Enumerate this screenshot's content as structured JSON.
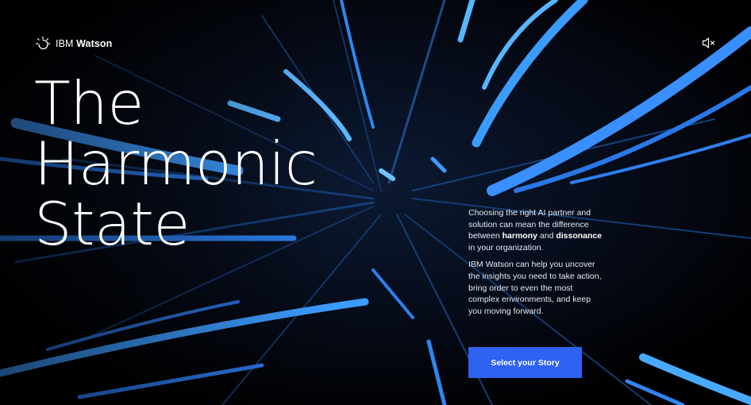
{
  "brand": {
    "logo_icon": "ibm-watson-icon",
    "prefix": "IBM",
    "name": "Watson"
  },
  "controls": {
    "mute_icon": "speaker-muted-icon"
  },
  "hero": {
    "line1": "The",
    "line2": "Harmonic",
    "line3": "State"
  },
  "intro": {
    "p1_a": "Choosing the right AI partner and solution can mean the difference between ",
    "p1_b": "harmony",
    "p1_c": " and ",
    "p1_d": "dissonance",
    "p1_e": " in your organization.",
    "p2": "IBM Watson can help you uncover the insights you need to take action, bring order to even the most complex environments, and keep you moving forward."
  },
  "cta": {
    "label": "Select your Story"
  },
  "colors": {
    "accent": "#2f62f1",
    "streak": "#3aa0ff",
    "background": "#02050c"
  }
}
